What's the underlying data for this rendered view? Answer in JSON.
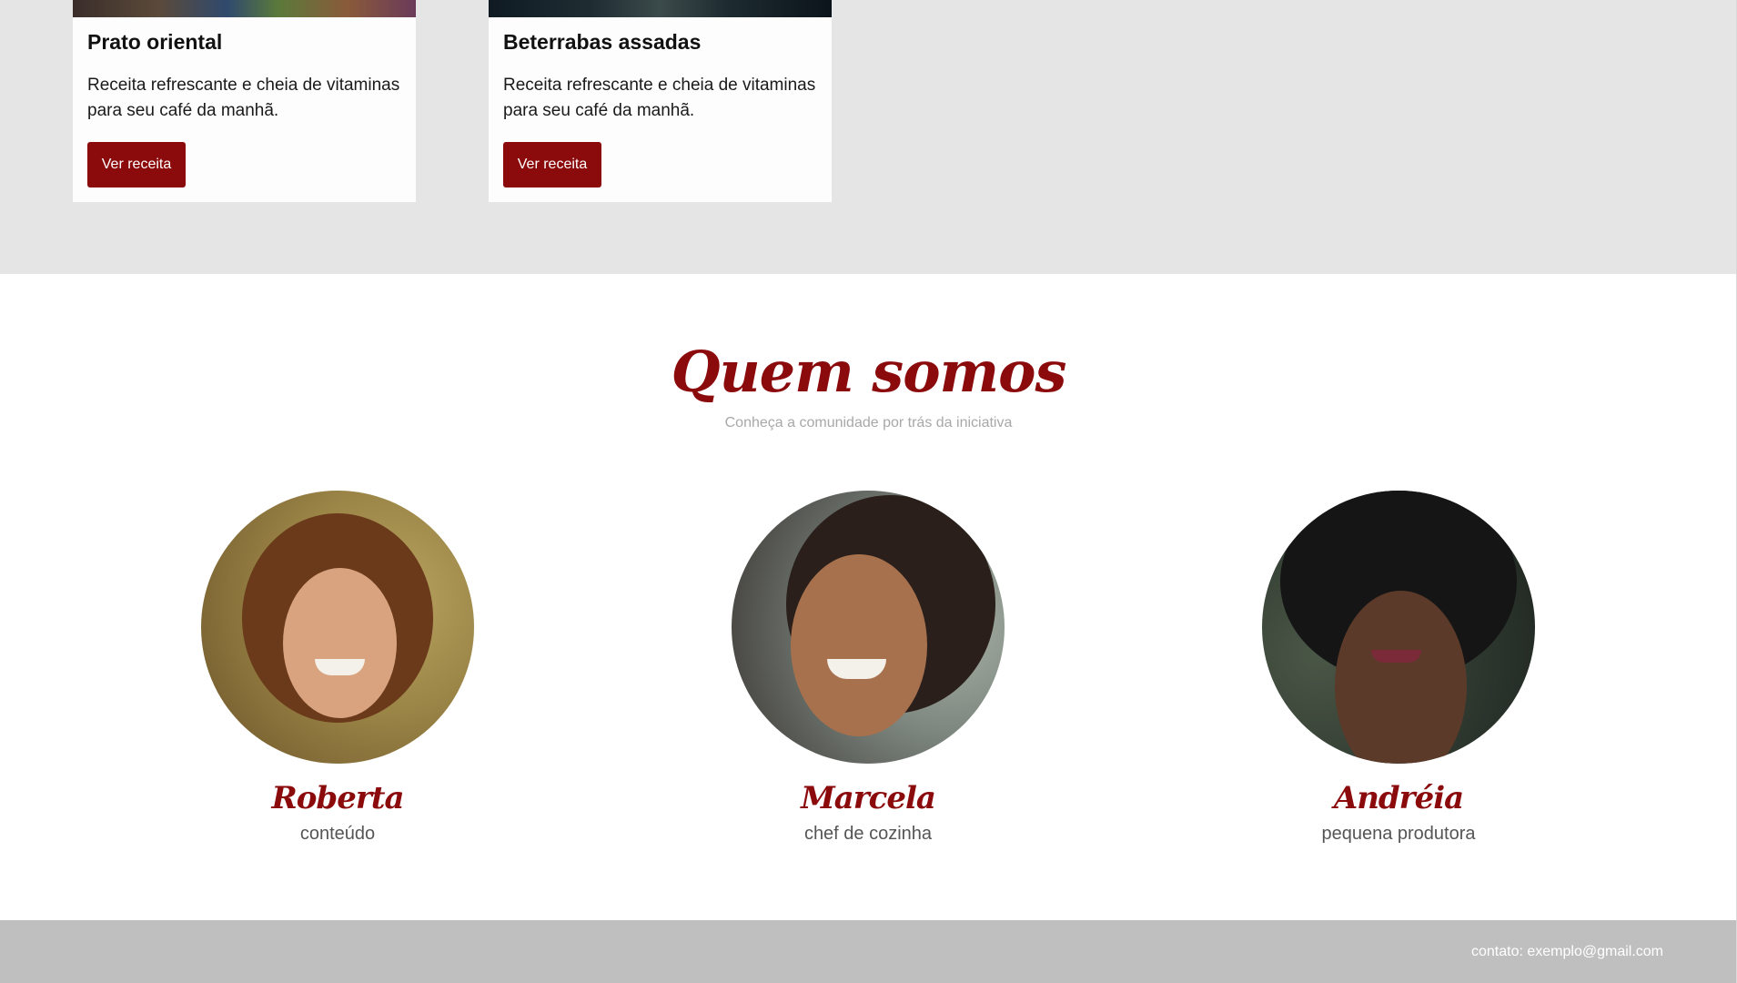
{
  "recipes": {
    "cards": [
      {
        "title": "Prato oriental",
        "description": "Receita refrescante e cheia de vitaminas para seu café da manhã.",
        "button_label": "Ver receita"
      },
      {
        "title": "Beterrabas assadas",
        "description": "Receita refrescante e cheia de vitaminas para seu café da manhã.",
        "button_label": "Ver receita"
      }
    ]
  },
  "about": {
    "title": "Quem somos",
    "subtitle": "Conheça a comunidade por trás da iniciativa",
    "members": [
      {
        "name": "Roberta",
        "role": "conteúdo"
      },
      {
        "name": "Marcela",
        "role": "chef de cozinha"
      },
      {
        "name": "Andréia",
        "role": "pequena produtora"
      }
    ]
  },
  "footer": {
    "contact": "contato: exemplo@gmail.com"
  },
  "colors": {
    "accent": "#8b0a0c",
    "section_bg": "#e5e5e5",
    "footer_bg": "#bfbfbf"
  }
}
